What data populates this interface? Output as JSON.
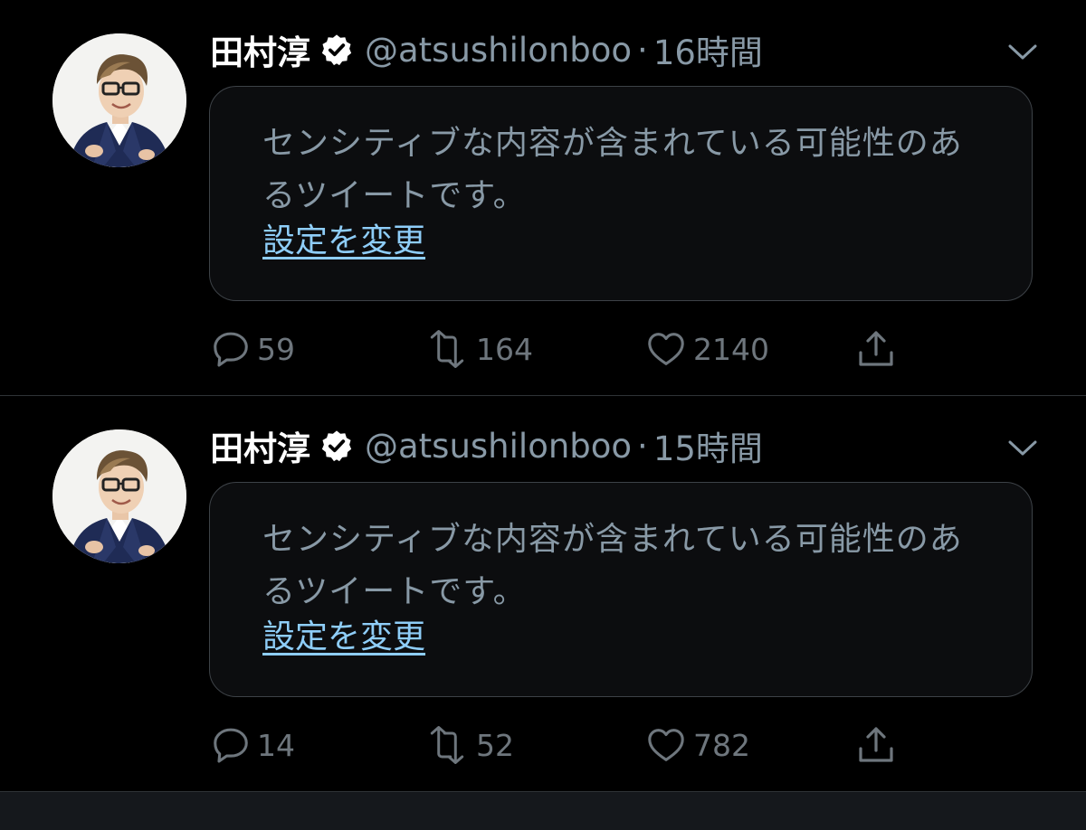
{
  "tweets": [
    {
      "display_name": "田村淳",
      "handle": "@atsushilonboo",
      "separator": "·",
      "time": "16時間",
      "sensitive_notice": "センシティブな内容が含まれている可能性のあるツイートです。",
      "settings_link": "設定を変更",
      "reply_count": "59",
      "retweet_count": "164",
      "like_count": "2140"
    },
    {
      "display_name": "田村淳",
      "handle": "@atsushilonboo",
      "separator": "·",
      "time": "15時間",
      "sensitive_notice": "センシティブな内容が含まれている可能性のあるツイートです。",
      "settings_link": "設定を変更",
      "reply_count": "14",
      "retweet_count": "52",
      "like_count": "782"
    }
  ],
  "icons": {
    "verified": "verified-badge-icon",
    "caret": "chevron-down-icon",
    "reply": "reply-icon",
    "retweet": "retweet-icon",
    "like": "heart-icon",
    "share": "share-icon"
  },
  "colors": {
    "background": "#000000",
    "secondary_text": "#8899a6",
    "link": "#8ecdf8",
    "action_icon": "#6e767d"
  }
}
